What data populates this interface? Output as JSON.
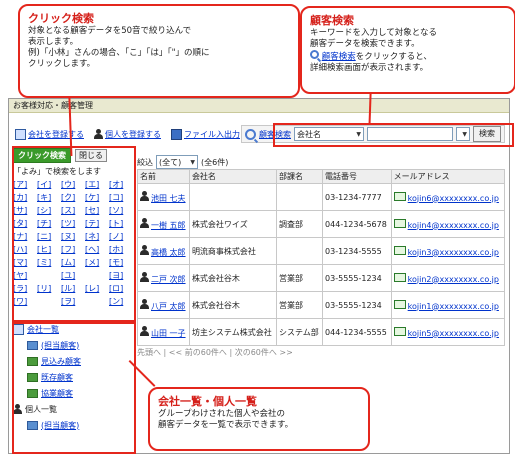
{
  "window": {
    "title": "お客様対応・顧客管理"
  },
  "toolbar": {
    "register_company": "会社を登録する",
    "register_person": "個人を登録する",
    "file_io": "ファイル入出力"
  },
  "search": {
    "link": "顧客検索",
    "field_select": "会社名",
    "field_options": [
      "会社名"
    ],
    "button": "検索"
  },
  "kana_panel": {
    "title": "クリック検索",
    "close": "閉じる",
    "hint": "「よみ」で検索をします",
    "kana": [
      "[ア]",
      "[イ]",
      "[ウ]",
      "[エ]",
      "[オ]",
      "[カ]",
      "[キ]",
      "[ク]",
      "[ケ]",
      "[コ]",
      "[サ]",
      "[シ]",
      "[ス]",
      "[セ]",
      "[ソ]",
      "[タ]",
      "[チ]",
      "[ツ]",
      "[テ]",
      "[ト]",
      "[ナ]",
      "[ニ]",
      "[ヌ]",
      "[ネ]",
      "[ノ]",
      "[ハ]",
      "[ヒ]",
      "[フ]",
      "[ヘ]",
      "[ホ]",
      "[マ]",
      "[ミ]",
      "[ム]",
      "[メ]",
      "[モ]",
      "[ヤ]",
      "",
      "[ユ]",
      "",
      "[ヨ]",
      "[ラ]",
      "[リ]",
      "[ル]",
      "[レ]",
      "[ロ]",
      "[ワ]",
      "",
      "[ヲ]",
      "",
      "[ン]"
    ]
  },
  "groups": {
    "company_list": "会社一覧",
    "company_items": [
      "(担当顧客)",
      "見込み顧客",
      "既存顧客",
      "協業顧客"
    ],
    "person_list": "個人一覧",
    "person_items": [
      "(担当顧客)"
    ]
  },
  "filter": {
    "label": "絞込",
    "select": "(全て)",
    "count": "(全6件)"
  },
  "table": {
    "headers": [
      "名前",
      "会社名",
      "部課名",
      "電話番号",
      "メールアドレス"
    ],
    "rows": [
      [
        "池田 七夫",
        "",
        "",
        "03-1234-7777",
        "kojin6@xxxxxxxx.co.jp"
      ],
      [
        "一樹 五郎",
        "株式会社ワイズ",
        "調査部",
        "044-1234-5678",
        "kojin4@xxxxxxxx.co.jp"
      ],
      [
        "高橋 太郎",
        "明流商事株式会社",
        "",
        "03-1234-5555",
        "kojin3@xxxxxxxx.co.jp"
      ],
      [
        "二戸 次郎",
        "株式会社谷木",
        "営業部",
        "03-5555-1234",
        "kojin2@xxxxxxxx.co.jp"
      ],
      [
        "八戸 太郎",
        "株式会社谷木",
        "営業部",
        "03-5555-1234",
        "kojin1@xxxxxxxx.co.jp"
      ],
      [
        "山田 一子",
        "坊主システム株式会社",
        "システム部",
        "044-1234-5555",
        "kojin5@xxxxxxxx.co.jp"
      ]
    ]
  },
  "pager": "先頭へ | << 前の60件へ | 次の60件へ >>",
  "callouts": {
    "kana": {
      "title": "クリック検索",
      "lines": [
        "対象となる顧客データを50音で絞り込んで",
        "表示します。",
        "例)「小林」さんの場合、「こ」「は」「\"」の順に",
        "クリックします。"
      ]
    },
    "search": {
      "title": "顧客検索",
      "lines": [
        "キーワードを入力して対象となる",
        "顧客データを検索できます。"
      ],
      "link_word": "顧客検索",
      "after_link": "をクリックすると、",
      "last": "詳細検索画面が表示されます。"
    },
    "list": {
      "title": "会社一覧・個人一覧",
      "lines": [
        "グループわけされた個人や会社の",
        "顧客データを一覧で表示できます。"
      ]
    }
  }
}
